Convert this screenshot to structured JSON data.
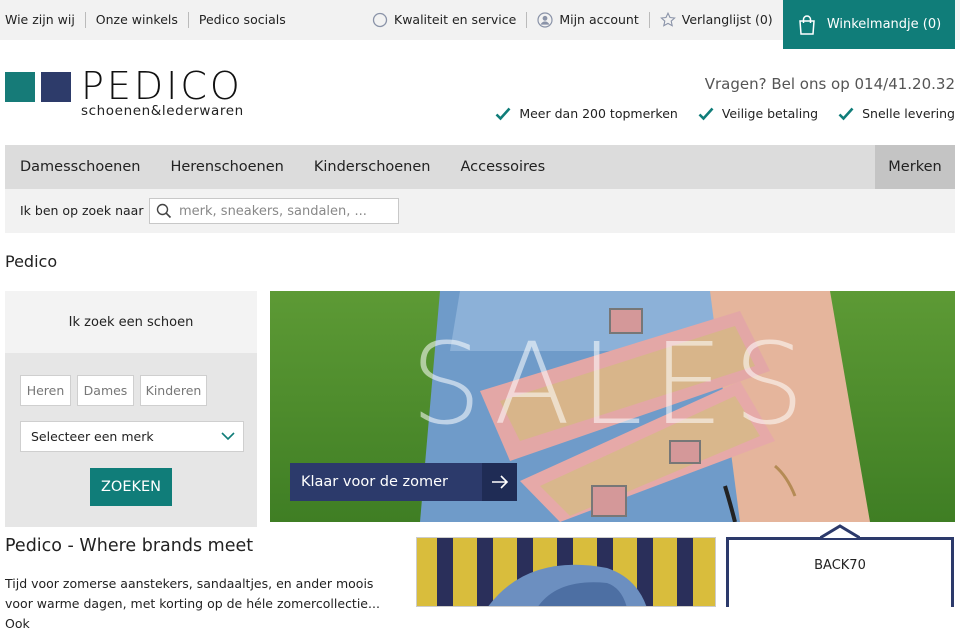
{
  "topbar": {
    "links": [
      "Wie zijn wij",
      "Onze winkels",
      "Pedico socials"
    ],
    "quality": "Kwaliteit en service",
    "account": "Mijn account",
    "wishlist": "Verlanglijst (0)",
    "cart": "Winkelmandje (0)"
  },
  "brand": {
    "name": "PEDICO",
    "subtitle": "schoenen&lederwaren",
    "phone": "Vragen? Bel ons op 014/41.20.32",
    "usps": [
      "Meer dan 200 topmerken",
      "Veilige betaling",
      "Snelle levering"
    ]
  },
  "nav": {
    "items": [
      "Damesschoenen",
      "Herenschoenen",
      "Kinderschoenen",
      "Accessoires"
    ],
    "brands": "Merken"
  },
  "search": {
    "label": "Ik ben op zoek naar",
    "placeholder": "merk, sneakers, sandalen, ..."
  },
  "breadcrumb": "Pedico",
  "finder": {
    "title": "Ik zoek een schoen",
    "options": [
      "Heren",
      "Dames",
      "Kinderen"
    ],
    "select": "Selecteer een merk",
    "button": "ZOEKEN"
  },
  "hero": {
    "overlay_text": "SALES",
    "cta": "Klaar voor de zomer"
  },
  "intro": {
    "title": "Pedico - Where brands meet",
    "text": "Tijd voor zomerse aanstekers, sandaaltjes, en ander moois voor warme dagen, met korting op de héle zomercollectie... Ook"
  },
  "voucher": {
    "code": "BACK70"
  },
  "colors": {
    "teal": "#107d79",
    "navy": "#2c3a6b"
  }
}
